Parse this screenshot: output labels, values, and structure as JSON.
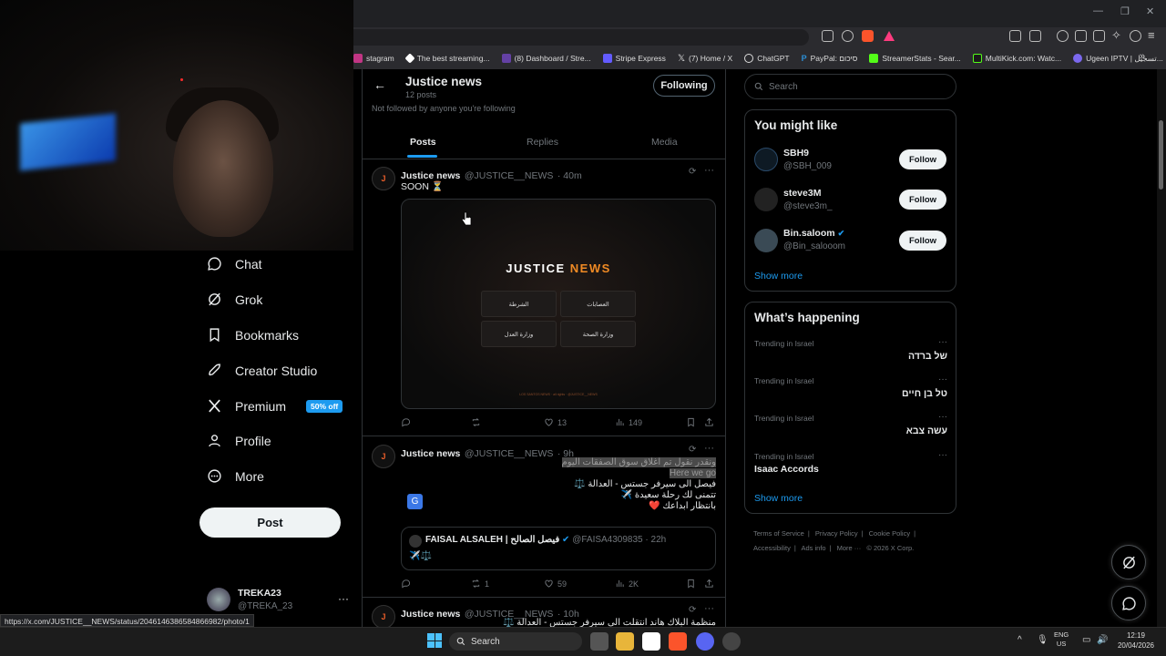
{
  "bookmarks": [
    {
      "label": "stagram",
      "color": "#c13584"
    },
    {
      "label": "The best streaming...",
      "color": "#ffffff"
    },
    {
      "label": "(8) Dashboard / Stre...",
      "color": "#6441a5"
    },
    {
      "label": "Stripe Express",
      "color": "#635bff"
    },
    {
      "label": "(7) Home / X",
      "color": "#000000"
    },
    {
      "label": "ChatGPT",
      "color": "#10a37f"
    },
    {
      "label": "PayPal: סיכום",
      "color": "#003087"
    },
    {
      "label": "StreamerStats - Sear...",
      "color": "#53fc18"
    },
    {
      "label": "MultiKick.com: Watc...",
      "color": "#53fc18"
    },
    {
      "label": "Ugeen IPTV | تسجيل...",
      "color": "#7b68ee"
    }
  ],
  "nav": {
    "chat": "Chat",
    "grok": "Grok",
    "bookmarks": "Bookmarks",
    "creator_studio": "Creator Studio",
    "premium": "Premium",
    "premium_badge": "50% off",
    "profile": "Profile",
    "more": "More",
    "post_button": "Post"
  },
  "account": {
    "name": "TREKA23",
    "handle": "@TREKA_23",
    "more": "···"
  },
  "status_url": "https://x.com/JUSTICE__NEWS/status/2046146386584866982/photo/1",
  "profile": {
    "name": "Justice news",
    "posts_count": "12 posts",
    "note": "Not followed by anyone you're following",
    "following_button": "Following"
  },
  "tabs": {
    "posts": "Posts",
    "replies": "Replies",
    "media": "Media"
  },
  "posts": [
    {
      "author": "Justice news",
      "handle": "@JUSTICE__NEWS",
      "time": "· 40m",
      "text": "SOON ⏳",
      "media": {
        "title_a": "JUSTICE",
        "title_b": "NEWS",
        "buttons": [
          "الشرطة",
          "العصابات",
          "وزارة العدل",
          "وزارة الصحة"
        ],
        "footer": "LOS SANTOS NEWS · all rights · @JUSTICE__NEWS"
      },
      "replies": "",
      "reposts": "",
      "likes": "13",
      "views": "149"
    },
    {
      "author": "Justice news",
      "handle": "@JUSTICE__NEWS",
      "time": "· 9h",
      "lines": [
        {
          "text": "ونقدر نقول تم اغلاق سوق الصفقات اليوم",
          "highlight": true
        },
        {
          "text": "Here we go",
          "highlight": true
        },
        {
          "text": "فيصل الى سيرفر جستس - العدالة ⚖️",
          "highlight": false
        },
        {
          "text": "تتمنى لك رحلة سعيدة ✈️",
          "highlight": false
        },
        {
          "text": "بانتظار ابداعك ❤️",
          "highlight": false
        }
      ],
      "quote": {
        "name": "FAISAL ALSALEH | فيصل الصالح",
        "handle": "@FAISA4309835",
        "time": "· 22h",
        "text": "✈️⚖️"
      },
      "replies": "",
      "reposts": "1",
      "likes": "59",
      "views": "2K"
    },
    {
      "author": "Justice news",
      "handle": "@JUSTICE__NEWS",
      "time": "· 10h",
      "text": "منظمة البلاك هاند انتقلت الى سيرفر جستس - العدالة ⚖️"
    }
  ],
  "search": {
    "placeholder": "Search"
  },
  "you_might_like": {
    "title": "You might like",
    "users": [
      {
        "name": "SBH9",
        "handle": "@SBH_009",
        "verified": false,
        "follow": "Follow"
      },
      {
        "name": "steve3M",
        "handle": "@steve3m_",
        "verified": false,
        "follow": "Follow"
      },
      {
        "name": "Bin.saloom",
        "handle": "@Bin_salooom",
        "verified": true,
        "follow": "Follow"
      }
    ],
    "show_more": "Show more"
  },
  "whats_happening": {
    "title": "What’s happening",
    "trends": [
      {
        "meta": "Trending in Israel",
        "topic": "של ברדה",
        "rtl": true
      },
      {
        "meta": "Trending in Israel",
        "topic": "טל בן חיים",
        "rtl": true
      },
      {
        "meta": "Trending in Israel",
        "topic": "עשה צבא",
        "rtl": true
      },
      {
        "meta": "Trending in Israel",
        "topic": "Isaac Accords",
        "rtl": false
      }
    ],
    "show_more": "Show more"
  },
  "footer": [
    "Terms of Service",
    "|",
    "Privacy Policy",
    "|",
    "Cookie Policy",
    "|",
    "Accessibility",
    "|",
    "Ads info",
    "|",
    "More ···",
    "© 2026 X Corp."
  ],
  "taskbar": {
    "search": "Search",
    "lang_1": "ENG",
    "lang_2": "US",
    "time": "12:19",
    "date": "20/04/2026"
  }
}
